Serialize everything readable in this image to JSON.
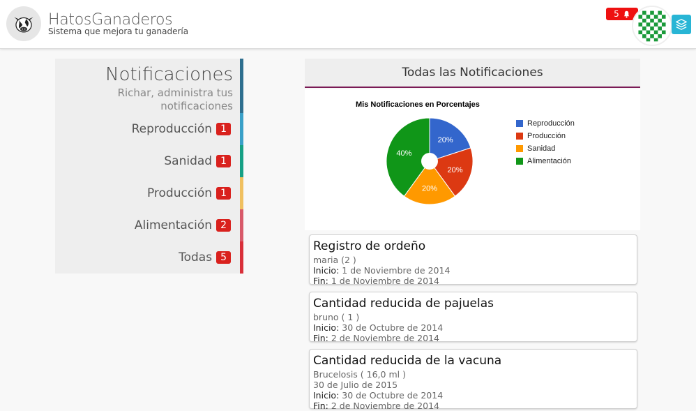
{
  "header": {
    "brand_title": "HatosGanaderos",
    "brand_subtitle": "Sistema que mejora tu ganadería",
    "notification_count": "5",
    "logo_icon": "cow-icon",
    "bell_icon": "bell-icon",
    "layers_icon": "layers-icon",
    "accent_color": "#28b5d5",
    "badge_color": "#e11111"
  },
  "sidebar": {
    "title": "Notificaciones",
    "subtitle": "Richar, administra tus notificaciones",
    "items": [
      {
        "label": "Reproducción",
        "count": "1",
        "color": "#3aa0c8"
      },
      {
        "label": "Sanidad",
        "count": "1",
        "color": "#16a085"
      },
      {
        "label": "Producción",
        "count": "1",
        "color": "#f0c060"
      },
      {
        "label": "Alimentación",
        "count": "2",
        "color": "#d85a6a"
      },
      {
        "label": "Todas",
        "count": "5",
        "color": "#d9303a"
      }
    ]
  },
  "main": {
    "header_title": "Todas las Notificaciones",
    "header_border_color": "#7a1a55"
  },
  "chart_data": {
    "type": "pie",
    "title": "Mis Notificaciones en Porcentajes",
    "categories": [
      "Reproducción",
      "Producción",
      "Sanidad",
      "Alimentación"
    ],
    "values": [
      20,
      20,
      20,
      40
    ],
    "labels": [
      "20%",
      "20%",
      "20%",
      "40%"
    ],
    "colors": [
      "#3366cc",
      "#dc3912",
      "#ff9900",
      "#109618"
    ],
    "legend_position": "right",
    "donut_hole": true
  },
  "notifications": [
    {
      "title": "Registro de ordeño",
      "subtitle": "maria (2 )",
      "extra": "",
      "start_label": "Inicio:",
      "start_value": " 1 de Noviembre de 2014",
      "end_label": "Fin:",
      "end_value": " 1 de Noviembre de 2014"
    },
    {
      "title": "Cantidad reducida de pajuelas",
      "subtitle": "bruno ( 1 )",
      "extra": "",
      "start_label": "Inicio:",
      "start_value": " 30 de Octubre de 2014",
      "end_label": "Fin:",
      "end_value": " 2 de Noviembre de 2014"
    },
    {
      "title": "Cantidad reducida de la vacuna",
      "subtitle": "Brucelosis ( 16,0 ml )",
      "extra": "30 de Julio de 2015",
      "start_label": "Inicio:",
      "start_value": " 30 de Octubre de 2014",
      "end_label": "Fin:",
      "end_value": " 2 de Noviembre de 2014"
    }
  ]
}
